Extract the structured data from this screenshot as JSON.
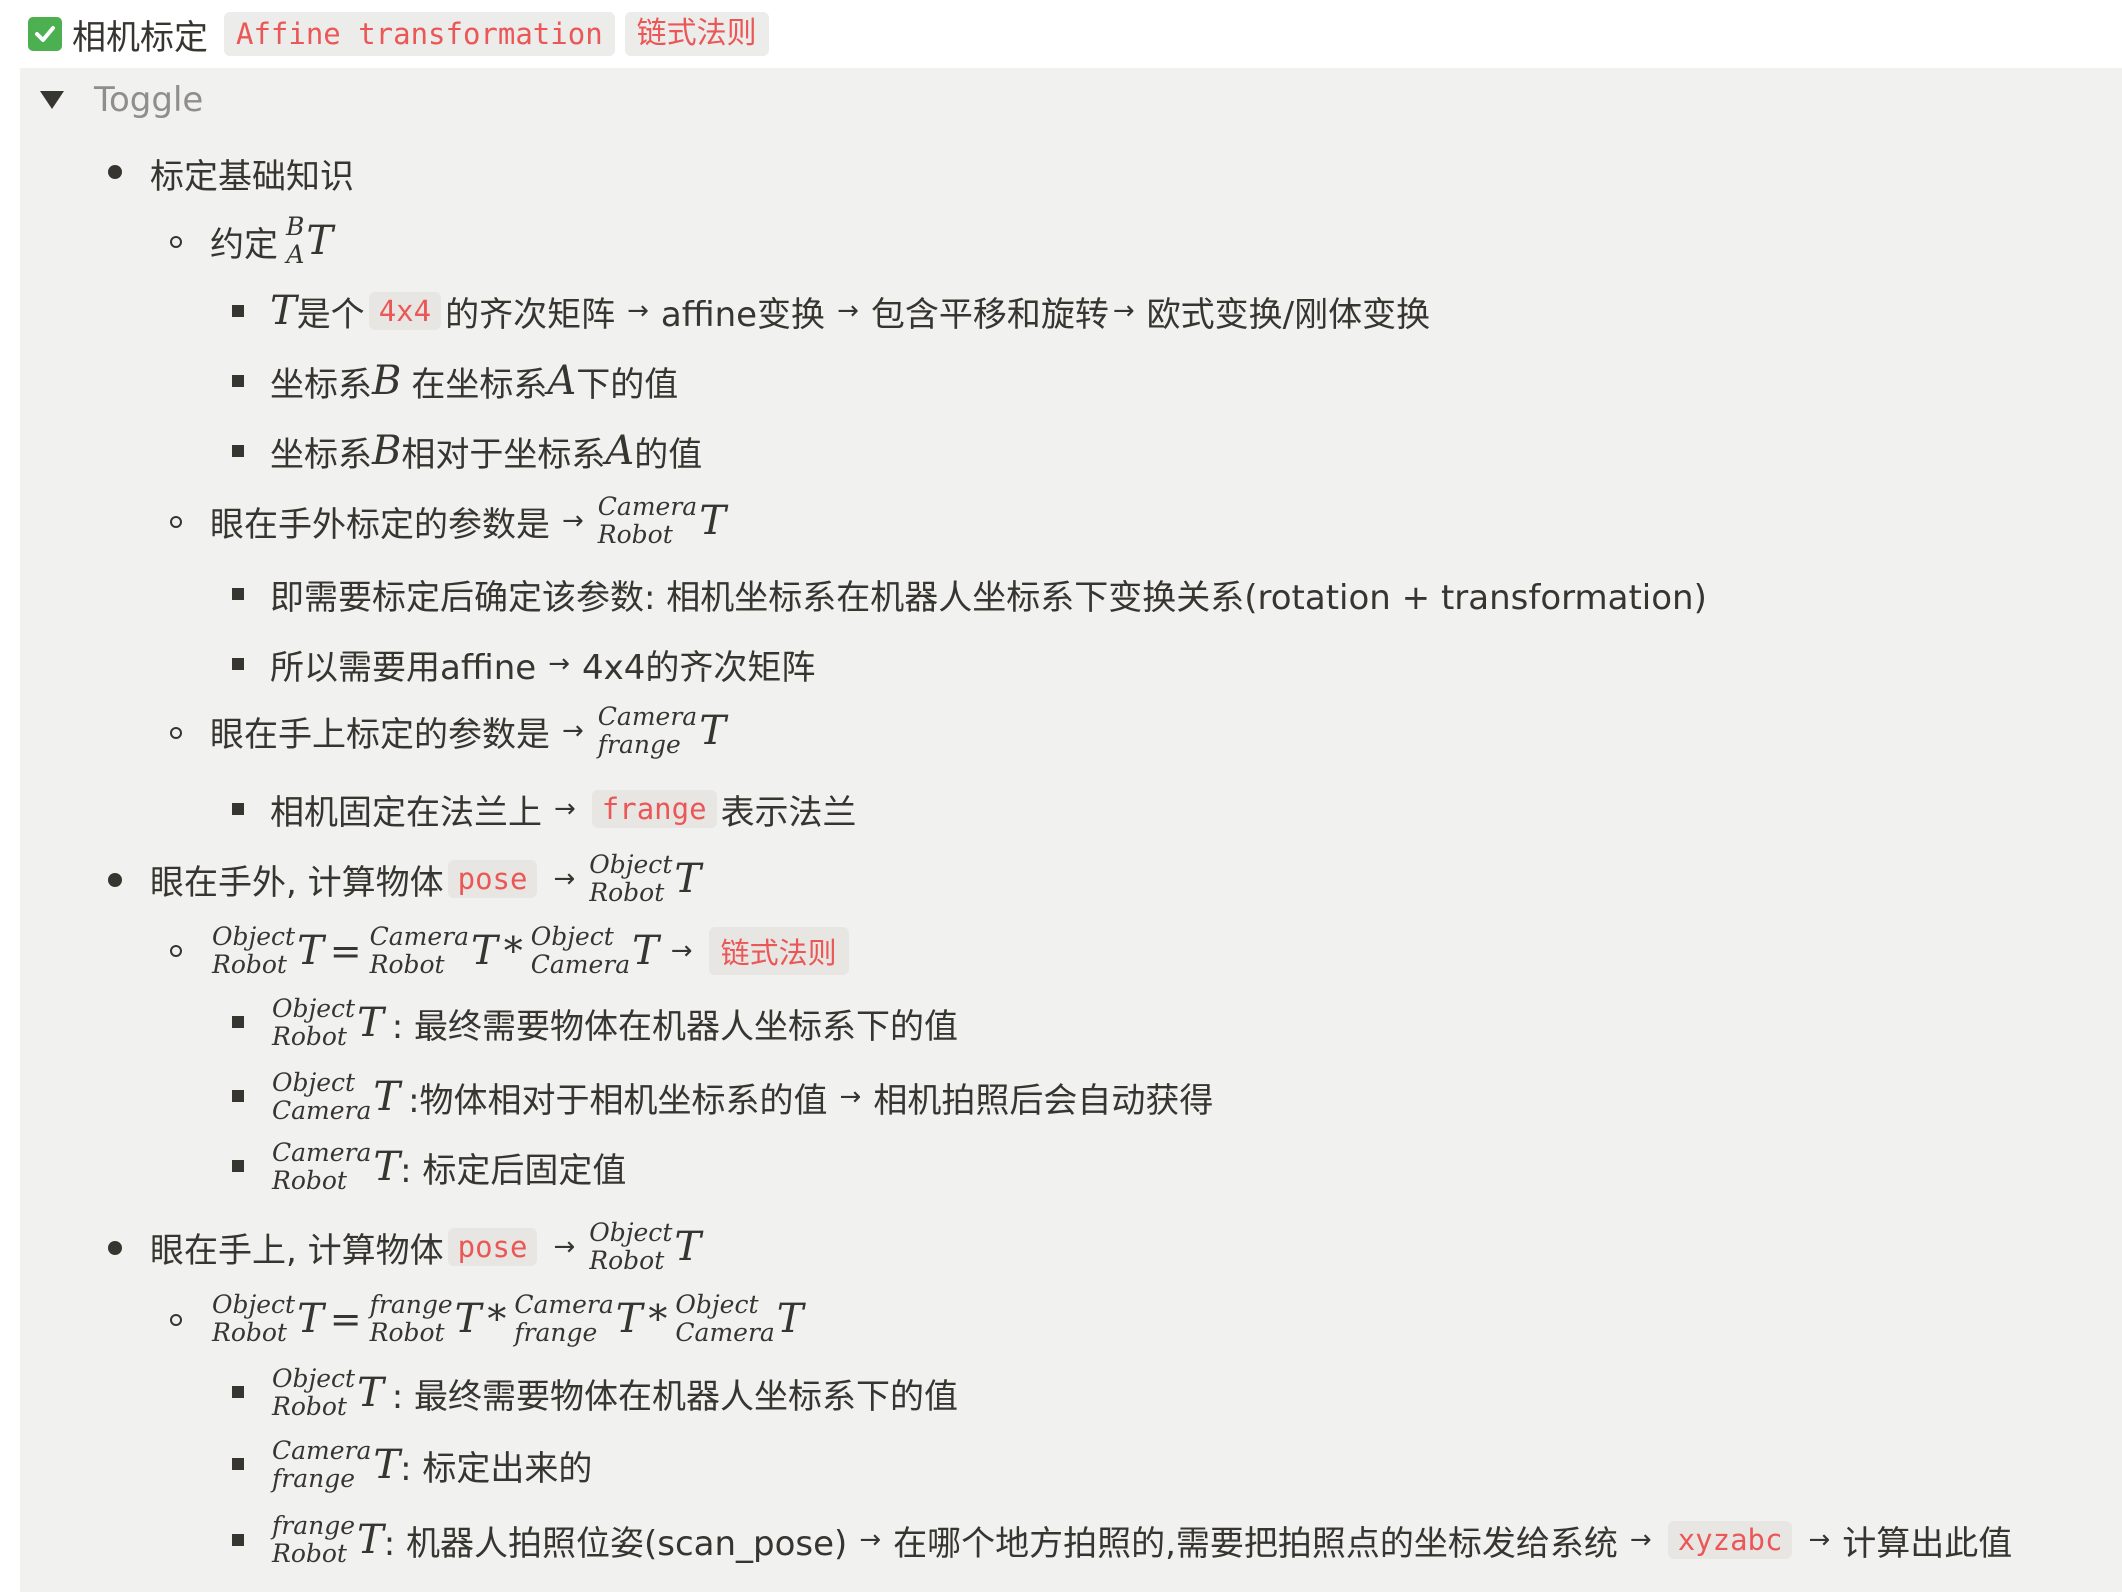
{
  "header": {
    "title": "相机标定",
    "tags": [
      "Affine transformation",
      "链式法则"
    ]
  },
  "toggle": {
    "label": "Toggle"
  },
  "text": {
    "s1": "标定基础知识",
    "s1a": "约定",
    "s1a1_a": "是个",
    "s1a1_code": "4x4",
    "s1a1_b": "的齐次矩阵",
    "s1a1_c": "affine变换",
    "s1a1_d": "包含平移和旋转",
    "s1a1_e": "欧式变换/刚体变换",
    "s1a2_a": "坐标系",
    "s1a2_b": "在坐标系",
    "s1a2_c": "下的值",
    "s1a3_a": "坐标系",
    "s1a3_b": "相对于坐标系",
    "s1a3_c": "的值",
    "s1b": "眼在手外标定的参数是",
    "s1b1": "即需要标定后确定该参数: 相机坐标系在机器人坐标系下变换关系(rotation + transformation)",
    "s1b2_a": "所以需要用affine",
    "s1b2_b": "4x4的齐次矩阵",
    "s1c": "眼在手上标定的参数是",
    "s1c1_a": "相机固定在法兰上",
    "s1c1_code": "frange",
    "s1c1_b": "表示法兰",
    "s2_a": "眼在手外, 计算物体",
    "s2_code": "pose",
    "s2a_tag": "链式法则",
    "s2a1": ": 最终需要物体在机器人坐标系下的值",
    "s2a2_a": ":物体相对于相机坐标系的值",
    "s2a2_b": "相机拍照后会自动获得",
    "s2a3": ": 标定后固定值",
    "s3_a": "眼在手上, 计算物体",
    "s3_code": "pose",
    "s3a1": ": 最终需要物体在机器人坐标系下的值",
    "s3a2": ": 标定出来的",
    "s3a3_a": ": 机器人拍照位姿(scan_pose)",
    "s3a3_b": "在哪个地方拍照的,需要把拍照点的坐标发给系统",
    "s3a3_code": "xyzabc",
    "s3a3_c": "计算出此值"
  },
  "math": {
    "T": "T",
    "A": "A",
    "B": "B",
    "times": "*",
    "eq": "=",
    "arrow": "→",
    "object": "Object",
    "robot": "Robot",
    "camera": "Camera",
    "frange": "frange"
  }
}
